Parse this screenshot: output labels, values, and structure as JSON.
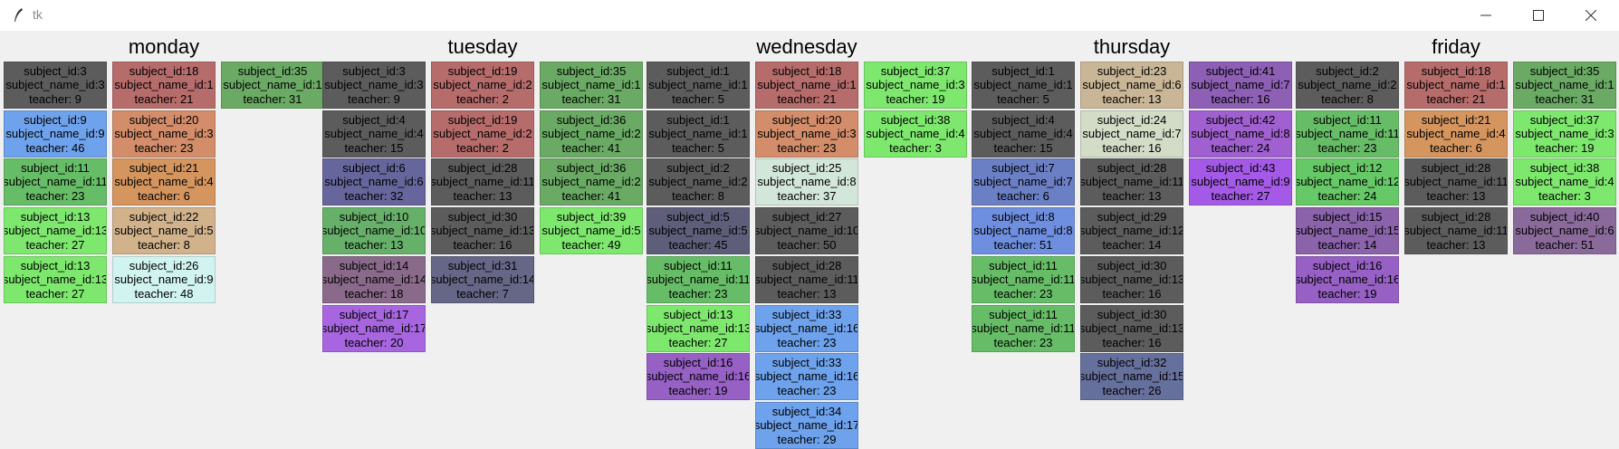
{
  "window": {
    "title": "tk"
  },
  "days": [
    {
      "name": "monday",
      "columns": [
        [
          {
            "subject_id": "subject_id:3",
            "subject_name_id": "subject_name_id:3",
            "teacher": "teacher: 9",
            "color": "#5c5c5c"
          },
          {
            "subject_id": "subject_id:9",
            "subject_name_id": "subject_name_id:9",
            "teacher": "teacher: 46",
            "color": "#6ea2ec"
          },
          {
            "subject_id": "subject_id:11",
            "subject_name_id": "subject_name_id:11",
            "teacher": "teacher: 23",
            "color": "#67bd67"
          },
          {
            "subject_id": "subject_id:13",
            "subject_name_id": "subject_name_id:13",
            "teacher": "teacher: 27",
            "color": "#7ee86e"
          },
          {
            "subject_id": "subject_id:13",
            "subject_name_id": "subject_name_id:13",
            "teacher": "teacher: 27",
            "color": "#7ee86e"
          }
        ],
        [
          {
            "subject_id": "subject_id:18",
            "subject_name_id": "subject_name_id:1",
            "teacher": "teacher: 21",
            "color": "#b56c6a"
          },
          {
            "subject_id": "subject_id:20",
            "subject_name_id": "subject_name_id:3",
            "teacher": "teacher: 23",
            "color": "#d38d6a"
          },
          {
            "subject_id": "subject_id:21",
            "subject_name_id": "subject_name_id:4",
            "teacher": "teacher: 6",
            "color": "#d4955f"
          },
          {
            "subject_id": "subject_id:22",
            "subject_name_id": "subject_name_id:5",
            "teacher": "teacher: 8",
            "color": "#d1b28b"
          },
          {
            "subject_id": "subject_id:26",
            "subject_name_id": "subject_name_id:9",
            "teacher": "teacher: 48",
            "color": "#d1f4f1"
          }
        ],
        [
          {
            "subject_id": "subject_id:35",
            "subject_name_id": "subject_name_id:1",
            "teacher": "teacher: 31",
            "color": "#6aaa64"
          }
        ]
      ]
    },
    {
      "name": "tuesday",
      "columns": [
        [
          {
            "subject_id": "subject_id:3",
            "subject_name_id": "subject_name_id:3",
            "teacher": "teacher: 9",
            "color": "#5c5c5c"
          },
          {
            "subject_id": "subject_id:4",
            "subject_name_id": "subject_name_id:4",
            "teacher": "teacher: 15",
            "color": "#5c5c5c"
          },
          {
            "subject_id": "subject_id:6",
            "subject_name_id": "subject_name_id:6",
            "teacher": "teacher: 32",
            "color": "#66669c"
          },
          {
            "subject_id": "subject_id:10",
            "subject_name_id": "subject_name_id:10",
            "teacher": "teacher: 13",
            "color": "#67b06a"
          },
          {
            "subject_id": "subject_id:14",
            "subject_name_id": "subject_name_id:14",
            "teacher": "teacher: 18",
            "color": "#8a6a8a"
          },
          {
            "subject_id": "subject_id:17",
            "subject_name_id": "subject_name_id:17",
            "teacher": "teacher: 20",
            "color": "#a766e0"
          }
        ],
        [
          {
            "subject_id": "subject_id:19",
            "subject_name_id": "subject_name_id:2",
            "teacher": "teacher: 2",
            "color": "#b56c6a"
          },
          {
            "subject_id": "subject_id:19",
            "subject_name_id": "subject_name_id:2",
            "teacher": "teacher: 2",
            "color": "#b56c6a"
          },
          {
            "subject_id": "subject_id:28",
            "subject_name_id": "subject_name_id:11",
            "teacher": "teacher: 13",
            "color": "#5c5c5c"
          },
          {
            "subject_id": "subject_id:30",
            "subject_name_id": "subject_name_id:13",
            "teacher": "teacher: 16",
            "color": "#5c5c5c"
          },
          {
            "subject_id": "subject_id:31",
            "subject_name_id": "subject_name_id:14",
            "teacher": "teacher: 7",
            "color": "#666686"
          }
        ],
        [
          {
            "subject_id": "subject_id:35",
            "subject_name_id": "subject_name_id:1",
            "teacher": "teacher: 31",
            "color": "#6aaa64"
          },
          {
            "subject_id": "subject_id:36",
            "subject_name_id": "subject_name_id:2",
            "teacher": "teacher: 41",
            "color": "#6aaa64"
          },
          {
            "subject_id": "subject_id:36",
            "subject_name_id": "subject_name_id:2",
            "teacher": "teacher: 41",
            "color": "#6aaa64"
          },
          {
            "subject_id": "subject_id:39",
            "subject_name_id": "subject_name_id:5",
            "teacher": "teacher: 49",
            "color": "#7ee86e"
          }
        ]
      ]
    },
    {
      "name": "wednesday",
      "columns": [
        [
          {
            "subject_id": "subject_id:1",
            "subject_name_id": "subject_name_id:1",
            "teacher": "teacher: 5",
            "color": "#5c5c5c"
          },
          {
            "subject_id": "subject_id:1",
            "subject_name_id": "subject_name_id:1",
            "teacher": "teacher: 5",
            "color": "#5c5c5c"
          },
          {
            "subject_id": "subject_id:2",
            "subject_name_id": "subject_name_id:2",
            "teacher": "teacher: 8",
            "color": "#5c5c5c"
          },
          {
            "subject_id": "subject_id:5",
            "subject_name_id": "subject_name_id:5",
            "teacher": "teacher: 45",
            "color": "#5e5e7a"
          },
          {
            "subject_id": "subject_id:11",
            "subject_name_id": "subject_name_id:11",
            "teacher": "teacher: 23",
            "color": "#67bd67"
          },
          {
            "subject_id": "subject_id:13",
            "subject_name_id": "subject_name_id:13",
            "teacher": "teacher: 27",
            "color": "#7ee86e"
          },
          {
            "subject_id": "subject_id:16",
            "subject_name_id": "subject_name_id:16",
            "teacher": "teacher: 19",
            "color": "#9660c4"
          }
        ],
        [
          {
            "subject_id": "subject_id:18",
            "subject_name_id": "subject_name_id:1",
            "teacher": "teacher: 21",
            "color": "#b56c6a"
          },
          {
            "subject_id": "subject_id:20",
            "subject_name_id": "subject_name_id:3",
            "teacher": "teacher: 23",
            "color": "#d38d6a"
          },
          {
            "subject_id": "subject_id:25",
            "subject_name_id": "subject_name_id:8",
            "teacher": "teacher: 37",
            "color": "#d3e6da"
          },
          {
            "subject_id": "subject_id:27",
            "subject_name_id": "subject_name_id:10",
            "teacher": "teacher: 50",
            "color": "#5c5c5c"
          },
          {
            "subject_id": "subject_id:28",
            "subject_name_id": "subject_name_id:11",
            "teacher": "teacher: 13",
            "color": "#5c5c5c"
          },
          {
            "subject_id": "subject_id:33",
            "subject_name_id": "subject_name_id:16",
            "teacher": "teacher: 23",
            "color": "#6ea2ec"
          },
          {
            "subject_id": "subject_id:33",
            "subject_name_id": "subject_name_id:16",
            "teacher": "teacher: 23",
            "color": "#6ea2ec"
          },
          {
            "subject_id": "subject_id:34",
            "subject_name_id": "subject_name_id:17",
            "teacher": "teacher: 29",
            "color": "#6ea2ec"
          }
        ],
        [
          {
            "subject_id": "subject_id:37",
            "subject_name_id": "subject_name_id:3",
            "teacher": "teacher: 19",
            "color": "#7ee86e"
          },
          {
            "subject_id": "subject_id:38",
            "subject_name_id": "subject_name_id:4",
            "teacher": "teacher: 3",
            "color": "#7ee86e"
          }
        ]
      ]
    },
    {
      "name": "thursday",
      "columns": [
        [
          {
            "subject_id": "subject_id:1",
            "subject_name_id": "subject_name_id:1",
            "teacher": "teacher: 5",
            "color": "#5c5c5c"
          },
          {
            "subject_id": "subject_id:4",
            "subject_name_id": "subject_name_id:4",
            "teacher": "teacher: 15",
            "color": "#5c5c5c"
          },
          {
            "subject_id": "subject_id:7",
            "subject_name_id": "subject_name_id:7",
            "teacher": "teacher: 6",
            "color": "#6a7fc4"
          },
          {
            "subject_id": "subject_id:8",
            "subject_name_id": "subject_name_id:8",
            "teacher": "teacher: 51",
            "color": "#6e8fe0"
          },
          {
            "subject_id": "subject_id:11",
            "subject_name_id": "subject_name_id:11",
            "teacher": "teacher: 23",
            "color": "#67bd67"
          },
          {
            "subject_id": "subject_id:11",
            "subject_name_id": "subject_name_id:11",
            "teacher": "teacher: 23",
            "color": "#67bd67"
          }
        ],
        [
          {
            "subject_id": "subject_id:23",
            "subject_name_id": "subject_name_id:6",
            "teacher": "teacher: 13",
            "color": "#c9b696"
          },
          {
            "subject_id": "subject_id:24",
            "subject_name_id": "subject_name_id:7",
            "teacher": "teacher: 16",
            "color": "#d3dcc7"
          },
          {
            "subject_id": "subject_id:28",
            "subject_name_id": "subject_name_id:11",
            "teacher": "teacher: 13",
            "color": "#5c5c5c"
          },
          {
            "subject_id": "subject_id:29",
            "subject_name_id": "subject_name_id:12",
            "teacher": "teacher: 14",
            "color": "#5c5c5c"
          },
          {
            "subject_id": "subject_id:30",
            "subject_name_id": "subject_name_id:13",
            "teacher": "teacher: 16",
            "color": "#5c5c5c"
          },
          {
            "subject_id": "subject_id:30",
            "subject_name_id": "subject_name_id:13",
            "teacher": "teacher: 16",
            "color": "#5c5c5c"
          },
          {
            "subject_id": "subject_id:32",
            "subject_name_id": "subject_name_id:15",
            "teacher": "teacher: 26",
            "color": "#66709c"
          }
        ],
        [
          {
            "subject_id": "subject_id:41",
            "subject_name_id": "subject_name_id:7",
            "teacher": "teacher: 16",
            "color": "#8d5fb5"
          },
          {
            "subject_id": "subject_id:42",
            "subject_name_id": "subject_name_id:8",
            "teacher": "teacher: 24",
            "color": "#a060d0"
          },
          {
            "subject_id": "subject_id:43",
            "subject_name_id": "subject_name_id:9",
            "teacher": "teacher: 27",
            "color": "#a45ae6"
          }
        ]
      ]
    },
    {
      "name": "friday",
      "columns": [
        [
          {
            "subject_id": "subject_id:2",
            "subject_name_id": "subject_name_id:2",
            "teacher": "teacher: 8",
            "color": "#5c5c5c"
          },
          {
            "subject_id": "subject_id:11",
            "subject_name_id": "subject_name_id:11",
            "teacher": "teacher: 23",
            "color": "#67bd67"
          },
          {
            "subject_id": "subject_id:12",
            "subject_name_id": "subject_name_id:12",
            "teacher": "teacher: 24",
            "color": "#67c867"
          },
          {
            "subject_id": "subject_id:15",
            "subject_name_id": "subject_name_id:15",
            "teacher": "teacher: 14",
            "color": "#8a63ab"
          },
          {
            "subject_id": "subject_id:16",
            "subject_name_id": "subject_name_id:16",
            "teacher": "teacher: 19",
            "color": "#9660c4"
          }
        ],
        [
          {
            "subject_id": "subject_id:18",
            "subject_name_id": "subject_name_id:1",
            "teacher": "teacher: 21",
            "color": "#b56c6a"
          },
          {
            "subject_id": "subject_id:21",
            "subject_name_id": "subject_name_id:4",
            "teacher": "teacher: 6",
            "color": "#d4955f"
          },
          {
            "subject_id": "subject_id:28",
            "subject_name_id": "subject_name_id:11",
            "teacher": "teacher: 13",
            "color": "#5c5c5c"
          },
          {
            "subject_id": "subject_id:28",
            "subject_name_id": "subject_name_id:11",
            "teacher": "teacher: 13",
            "color": "#5c5c5c"
          }
        ],
        [
          {
            "subject_id": "subject_id:35",
            "subject_name_id": "subject_name_id:1",
            "teacher": "teacher: 31",
            "color": "#6aaa64"
          },
          {
            "subject_id": "subject_id:37",
            "subject_name_id": "subject_name_id:3",
            "teacher": "teacher: 19",
            "color": "#7ee86e"
          },
          {
            "subject_id": "subject_id:38",
            "subject_name_id": "subject_name_id:4",
            "teacher": "teacher: 3",
            "color": "#7ee86e"
          },
          {
            "subject_id": "subject_id:40",
            "subject_name_id": "subject_name_id:6",
            "teacher": "teacher: 51",
            "color": "#8a6a9a"
          }
        ]
      ]
    }
  ]
}
